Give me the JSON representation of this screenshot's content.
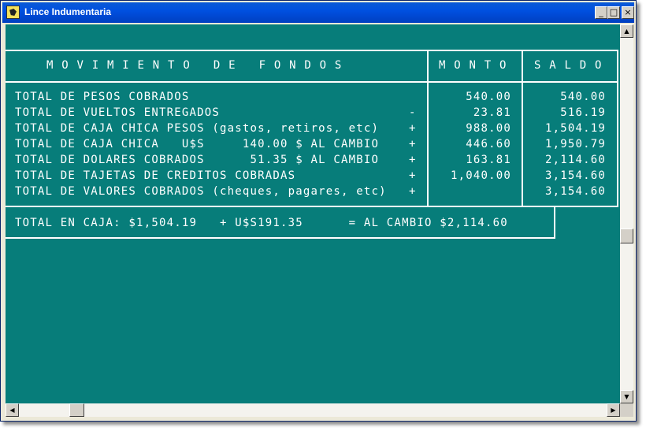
{
  "window": {
    "title": "Lince Indumentaria",
    "minimize_label": "_",
    "maximize_label": "□",
    "close_label": "×"
  },
  "report": {
    "header": {
      "title": "M O V I M I E N T O   D E   F O N D O S",
      "monto": "M O N T O",
      "saldo": "S A L D O"
    },
    "rows": [
      {
        "label": "TOTAL DE PESOS COBRADOS",
        "op": "",
        "monto": "540.00",
        "saldo": "540.00"
      },
      {
        "label": "TOTAL DE VUELTOS ENTREGADOS",
        "op": "-",
        "monto": "23.81",
        "saldo": "516.19"
      },
      {
        "label": "TOTAL DE CAJA CHICA PESOS (gastos, retiros, etc)",
        "op": "+",
        "monto": "988.00",
        "saldo": "1,504.19"
      },
      {
        "label": "TOTAL DE CAJA CHICA   U$S     140.00 $ AL CAMBIO",
        "op": "+",
        "monto": "446.60",
        "saldo": "1,950.79"
      },
      {
        "label": "TOTAL DE DOLARES COBRADOS      51.35 $ AL CAMBIO",
        "op": "+",
        "monto": "163.81",
        "saldo": "2,114.60"
      },
      {
        "label": "TOTAL DE TAJETAS DE CREDITOS COBRADAS",
        "op": "+",
        "monto": "1,040.00",
        "saldo": "3,154.60"
      },
      {
        "label": "TOTAL DE VALORES COBRADOS (cheques, pagares, etc)",
        "op": "+",
        "monto": "",
        "saldo": "3,154.60"
      }
    ],
    "total_line": "TOTAL EN CAJA: $1,504.19   + U$S191.35      = AL CAMBIO $2,114.60"
  },
  "scrollbars": {
    "up": "▲",
    "down": "▼",
    "left": "◀",
    "right": "▶"
  },
  "colors": {
    "console_background": "#077d7a",
    "text": "#ffffff",
    "titlebar": "#0050e0"
  }
}
